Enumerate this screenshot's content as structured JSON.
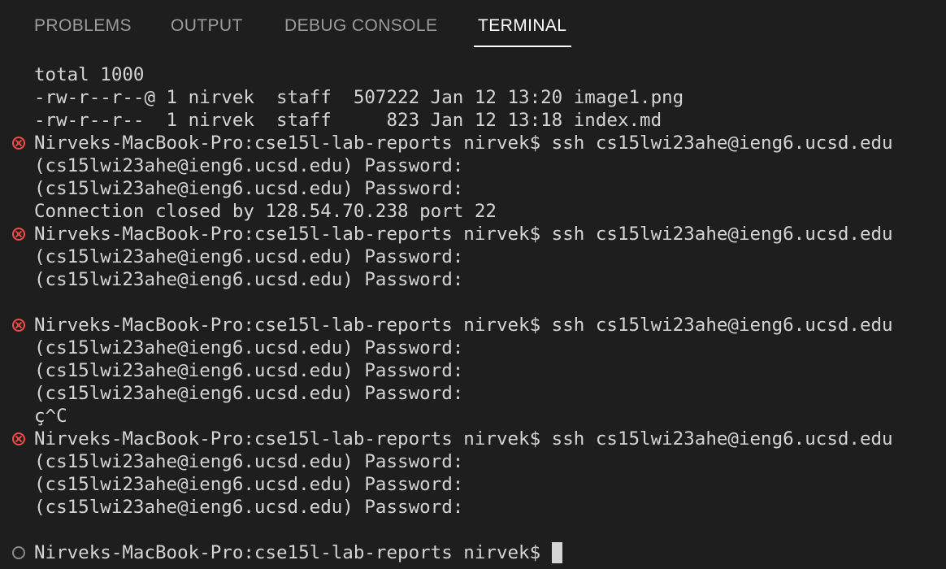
{
  "tabs": [
    {
      "label": "PROBLEMS",
      "active": false
    },
    {
      "label": "OUTPUT",
      "active": false
    },
    {
      "label": "DEBUG CONSOLE",
      "active": false
    },
    {
      "label": "TERMINAL",
      "active": true
    }
  ],
  "colors": {
    "background": "#1e1e1e",
    "text": "#d4d4d4",
    "inactive_tab": "#9b9b9b",
    "active_tab": "#ffffff",
    "error_marker": "#f14c4c",
    "idle_marker": "#8a8a8a"
  },
  "terminal": {
    "lines": [
      "total 1000",
      "-rw-r--r--@ 1 nirvek  staff  507222 Jan 12 13:20 image1.png",
      "-rw-r--r--  1 nirvek  staff     823 Jan 12 13:18 index.md",
      "Nirveks-MacBook-Pro:cse15l-lab-reports nirvek$ ssh cs15lwi23ahe@ieng6.ucsd.edu",
      "(cs15lwi23ahe@ieng6.ucsd.edu) Password:",
      "(cs15lwi23ahe@ieng6.ucsd.edu) Password:",
      "Connection closed by 128.54.70.238 port 22",
      "Nirveks-MacBook-Pro:cse15l-lab-reports nirvek$ ssh cs15lwi23ahe@ieng6.ucsd.edu",
      "(cs15lwi23ahe@ieng6.ucsd.edu) Password:",
      "(cs15lwi23ahe@ieng6.ucsd.edu) Password:",
      "",
      "Nirveks-MacBook-Pro:cse15l-lab-reports nirvek$ ssh cs15lwi23ahe@ieng6.ucsd.edu",
      "(cs15lwi23ahe@ieng6.ucsd.edu) Password:",
      "(cs15lwi23ahe@ieng6.ucsd.edu) Password:",
      "(cs15lwi23ahe@ieng6.ucsd.edu) Password:",
      "ç^C",
      "Nirveks-MacBook-Pro:cse15l-lab-reports nirvek$ ssh cs15lwi23ahe@ieng6.ucsd.edu",
      "(cs15lwi23ahe@ieng6.ucsd.edu) Password:",
      "(cs15lwi23ahe@ieng6.ucsd.edu) Password:",
      "(cs15lwi23ahe@ieng6.ucsd.edu) Password:",
      "",
      "Nirveks-MacBook-Pro:cse15l-lab-reports nirvek$ "
    ],
    "error_markers": {
      "icon": "error-circle-x-icon",
      "line_indexes": [
        3,
        7,
        11,
        16
      ]
    },
    "idle_marker": {
      "icon": "idle-circle-icon",
      "line_index": 21
    },
    "cursor": "block"
  }
}
